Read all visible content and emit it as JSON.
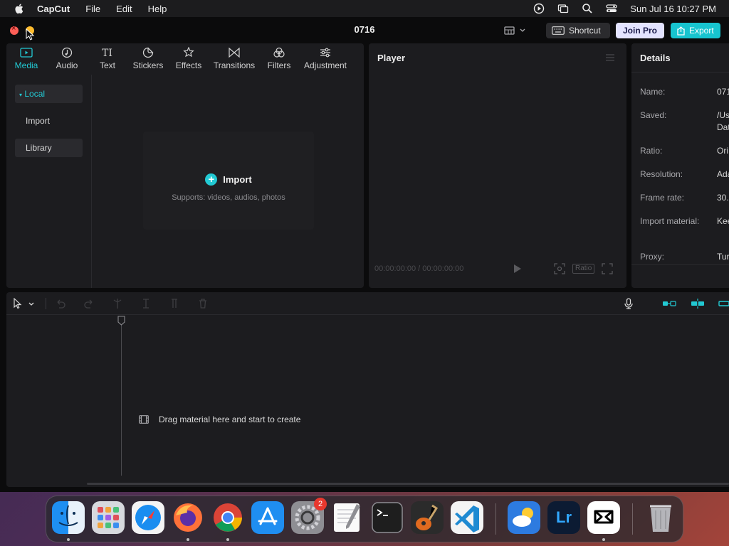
{
  "menubar": {
    "app_name": "CapCut",
    "items": [
      "File",
      "Edit",
      "Help"
    ],
    "datetime": "Sun Jul 16  10:27 PM"
  },
  "window": {
    "title": "0716",
    "shortcut_label": "Shortcut",
    "join_pro_label": "Join Pro",
    "export_label": "Export"
  },
  "media": {
    "tabs": [
      {
        "label": "Media",
        "icon": "media-icon",
        "active": true
      },
      {
        "label": "Audio",
        "icon": "audio-icon"
      },
      {
        "label": "Text",
        "icon": "text-icon"
      },
      {
        "label": "Stickers",
        "icon": "stickers-icon"
      },
      {
        "label": "Effects",
        "icon": "effects-icon"
      },
      {
        "label": "Transitions",
        "icon": "transitions-icon"
      },
      {
        "label": "Filters",
        "icon": "filters-icon"
      },
      {
        "label": "Adjustment",
        "icon": "adjustment-icon"
      }
    ],
    "sidebar": {
      "local": "Local",
      "import": "Import",
      "library": "Library"
    },
    "import_label": "Import",
    "import_sub": "Supports: videos, audios, photos"
  },
  "player": {
    "title": "Player",
    "timecode": "00:00:00:00 / 00:00:00:00",
    "ratio_label": "Ratio"
  },
  "details": {
    "title": "Details",
    "rows": [
      {
        "label": "Name:",
        "value": "071"
      },
      {
        "label": "Saved:",
        "value": "/Us",
        "value2": "Dat"
      },
      {
        "label": "Ratio:",
        "value": "Ori"
      },
      {
        "label": "Resolution:",
        "value": "Ada"
      },
      {
        "label": "Frame rate:",
        "value": "30."
      },
      {
        "label": "Import material:",
        "value": "Kee"
      },
      {
        "label": "Proxy:",
        "value": "Tur"
      }
    ]
  },
  "timeline": {
    "drop_hint": "Drag material here and start to create"
  },
  "dock": {
    "apps": [
      "finder-icon",
      "launchpad-icon",
      "safari-icon",
      "firefox-icon",
      "chrome-icon",
      "app-store-icon",
      "system-settings-icon",
      "textedit-icon",
      "terminal-icon",
      "garageband-icon",
      "vscode-icon",
      "weather-icon",
      "lightroom-icon",
      "capcut-icon",
      "trash-icon"
    ],
    "settings_badge": "2",
    "lightroom_label": "Lr"
  },
  "colors": {
    "accent": "#22c9d3",
    "export_bg": "#17c4cf",
    "join_pro_bg": "#e3e3ff",
    "panel_bg": "#1c1c1f"
  }
}
